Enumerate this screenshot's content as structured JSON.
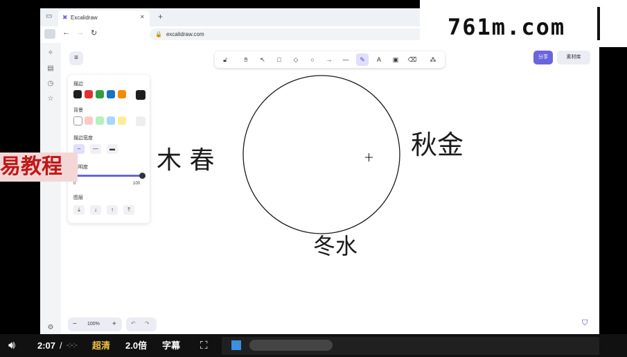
{
  "browser": {
    "tab_title": "Excalidraw",
    "tab_close": "✕",
    "new_tab": "+",
    "url": "excalidraw.com"
  },
  "app": {
    "menu_icon": "≡",
    "share_label": "分享",
    "library_label": "素材库",
    "panel": {
      "stroke_label": "描边",
      "background_label": "背景",
      "stroke_width_label": "描边宽度",
      "opacity_label": "透明度",
      "opacity_min": "0",
      "opacity_max": "100",
      "opacity_value": 1.0,
      "layers_label": "图层",
      "stroke_colors": [
        "#1e1e1e",
        "#e03131",
        "#2f9e44",
        "#1971c2",
        "#f08c00"
      ],
      "current_stroke": "#1e1e1e",
      "background_colors": [
        "#ffffff",
        "#ffc9c9",
        "#b2f2bb",
        "#a5d8ff",
        "#ffec99"
      ]
    },
    "zoom_level": "100%",
    "zoom_minus": "−",
    "zoom_plus": "+"
  },
  "canvas_text": {
    "left": "木 春",
    "right": "秋金",
    "bottom": "冬水"
  },
  "video": {
    "time_current": "2:07",
    "time_sep": "/",
    "time_total": "-:-:-",
    "quality": "超清",
    "speed": "2.0倍",
    "subtitles": "字幕"
  },
  "overlay": {
    "watermark": "761m.com",
    "promo": "易教程"
  },
  "colors": {
    "accent": "#6965db",
    "promo_red": "#c01818"
  }
}
